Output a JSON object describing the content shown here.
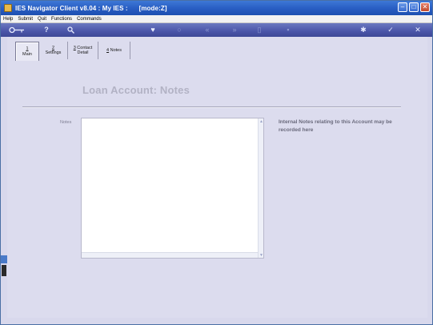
{
  "window": {
    "title": "IES Navigator Client v8.04 : My IES :      [mode:Z]"
  },
  "menubar": {
    "items": [
      "Help",
      "Submit",
      "Quit",
      "Functions",
      "Commands"
    ]
  },
  "toolbar": {
    "icons": [
      "key-icon",
      "help-icon",
      "search-icon",
      "heart-icon",
      "circle-icon",
      "rewind-icon",
      "fast-forward-icon",
      "page-icon",
      "print-icon",
      "settings-icon",
      "check-icon",
      "close-icon"
    ]
  },
  "tabs": [
    {
      "key": "1",
      "label": " Main"
    },
    {
      "key": "2",
      "label": " Settings"
    },
    {
      "key": "3",
      "label": " Contact",
      "label2": "Detail"
    },
    {
      "key": "4",
      "label": " Notes"
    }
  ],
  "page": {
    "title": "Loan Account: Notes",
    "notes_label": "Notes",
    "notes_value": "",
    "hint": "Internal Notes relating to this Account may be recorded here"
  },
  "colors": {
    "titlebar": "#2a5fc4",
    "toolbar": "#4a55a8",
    "background": "#dcdcee"
  }
}
